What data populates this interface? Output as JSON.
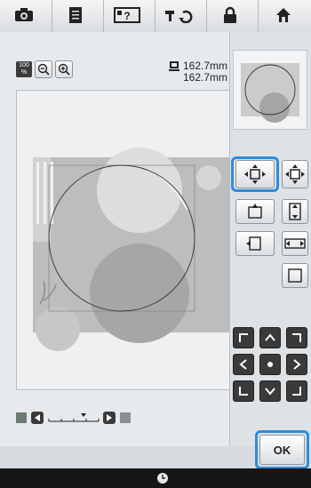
{
  "toolbar": {
    "icons": [
      "camera-icon",
      "page-icon",
      "help-icon",
      "machine-settings-icon",
      "lock-icon",
      "home-icon"
    ]
  },
  "zoom": {
    "level_top": "100",
    "level_bottom": "%"
  },
  "size": {
    "width": "162.7mm",
    "height": "162.7mm"
  },
  "buttons": {
    "ok_label": "OK"
  },
  "colors": {
    "highlight": "#2a8de0",
    "accent_dark": "#3a3a3a"
  }
}
